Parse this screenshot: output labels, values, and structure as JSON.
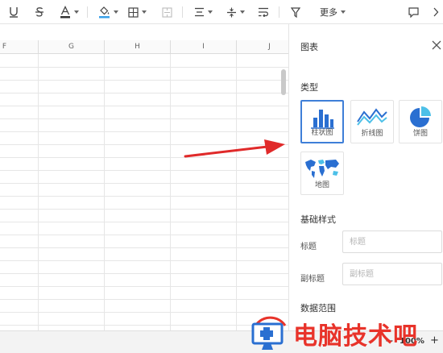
{
  "toolbar": {
    "more_label": "更多"
  },
  "sheet": {
    "columns": [
      "F",
      "G",
      "H",
      "I",
      "J"
    ]
  },
  "panel": {
    "title": "图表",
    "type_section": "类型",
    "chart_types": [
      {
        "label": "柱状图",
        "icon": "bar-chart-icon",
        "selected": true
      },
      {
        "label": "折线图",
        "icon": "line-chart-icon",
        "selected": false
      },
      {
        "label": "饼图",
        "icon": "pie-chart-icon",
        "selected": false
      },
      {
        "label": "地图",
        "icon": "map-chart-icon",
        "selected": false
      }
    ],
    "basic_style_section": "基础样式",
    "title_field": {
      "label": "标题",
      "placeholder": "标题",
      "value": ""
    },
    "subtitle_field": {
      "label": "副标题",
      "placeholder": "副标题",
      "value": ""
    },
    "data_range_section": "数据范围"
  },
  "statusbar": {
    "zoom": "100%"
  },
  "watermark": {
    "text": "电脑技术吧"
  },
  "colors": {
    "accent": "#3f7fd8",
    "arrow": "#e02a2a",
    "watermark": "#e8332a"
  }
}
